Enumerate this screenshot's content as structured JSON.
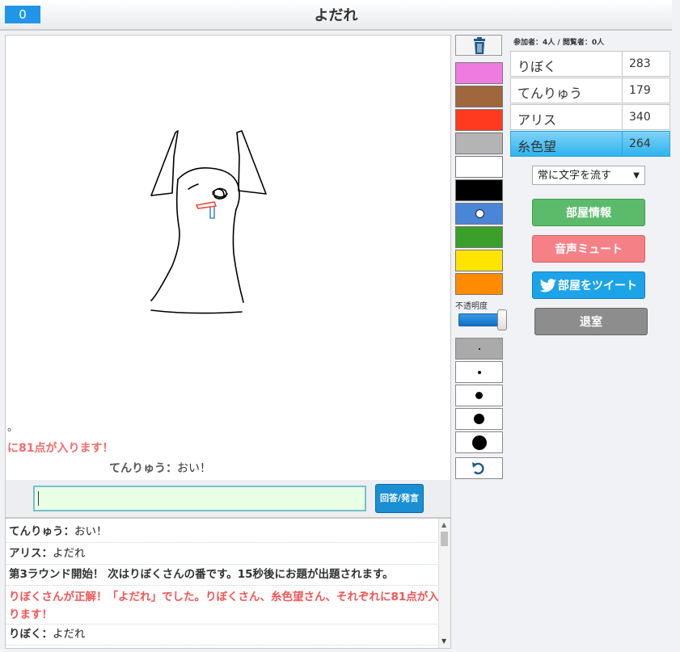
{
  "header": {
    "counter": "0",
    "title": "よだれ"
  },
  "canvas_overlay": {
    "line1": "。",
    "line2": "に81点が入ります！",
    "line3_speaker": "てんりゅう：",
    "line3_text": "おい！"
  },
  "input": {
    "placeholder": "",
    "value": "",
    "send_label": "回答/発言"
  },
  "log": [
    {
      "speaker": "てんりゅう：",
      "text": "おい！"
    },
    {
      "speaker": "アリス：",
      "text": "よだれ"
    },
    {
      "system": "第3ラウンド開始！ 次はりぼくさんの番です。15秒後にお題が出題されます。"
    },
    {
      "system_red": "りぼくさんが正解！「よだれ」でした。りぼくさん、糸色望さん、それぞれに81点が入ります！"
    },
    {
      "speaker": "りぼく：",
      "text": "よだれ"
    }
  ],
  "tools": {
    "colors": [
      "#f07be0",
      "#a0663c",
      "#ff3a1e",
      "#b4b4b4",
      "#ffffff",
      "#000000",
      "#4a86d8",
      "#3aa02a",
      "#ffe400",
      "#ff8c00"
    ],
    "opacity_label": "不透明度",
    "opacity_value": 1.0,
    "pen_sizes": [
      2,
      4,
      9,
      13,
      18
    ],
    "selected_pen_index": 0
  },
  "viewers": "参加者：4人 / 閲覧者：0人",
  "players": [
    {
      "name": "りぼく",
      "score": "283",
      "active": false
    },
    {
      "name": "てんりゅう",
      "score": "179",
      "active": false
    },
    {
      "name": "アリス",
      "score": "340",
      "active": false
    },
    {
      "name": "糸色望",
      "score": "264",
      "active": true
    }
  ],
  "settings": {
    "text_flow_select": "常に文字を流す",
    "room_info_label": "部屋情報",
    "mute_label": "音声ミュート",
    "tweet_label": "部屋をツイート",
    "leave_label": "退室"
  },
  "colors": {
    "accent_blue": "#2196e8",
    "active_player": "#2eb3ee",
    "info": "#5cbb6b",
    "mute": "#f58187",
    "tweet": "#1da3e8",
    "leave": "#8d8d8d",
    "system_red": "#f25555"
  }
}
